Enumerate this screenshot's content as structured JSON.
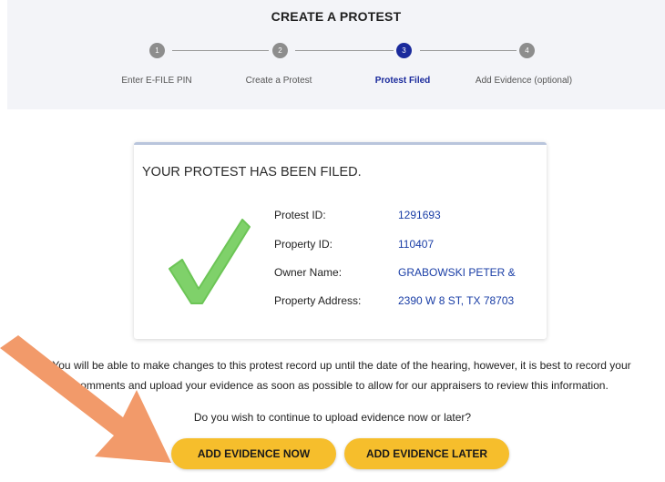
{
  "header": {
    "title": "CREATE A PROTEST",
    "steps": [
      {
        "number": "1",
        "label": "Enter E-FILE PIN"
      },
      {
        "number": "2",
        "label": "Create a Protest"
      },
      {
        "number": "3",
        "label": "Protest Filed",
        "active": true
      },
      {
        "number": "4",
        "label": "Add Evidence (optional)"
      }
    ]
  },
  "card": {
    "title": "YOUR PROTEST HAS BEEN FILED.",
    "rows": [
      {
        "label": "Protest ID:",
        "value": "1291693"
      },
      {
        "label": "Property ID:",
        "value": "110407"
      },
      {
        "label": "Owner Name:",
        "value": "GRABOWSKI PETER &"
      },
      {
        "label": "Property Address:",
        "value": "2390 W 8 ST, TX 78703"
      }
    ]
  },
  "info": {
    "line1": "You will be able to make changes to this protest record up until the date of the hearing, however, it is best to record your",
    "line2": "comments and upload your evidence as soon as possible to allow for our appraisers to review this information."
  },
  "question": "Do you wish to continue to upload evidence now or later?",
  "buttons": {
    "now": "ADD EVIDENCE NOW",
    "later": "ADD EVIDENCE LATER"
  },
  "colors": {
    "active_step": "#1a2a9c",
    "link_value": "#1a3ea6",
    "button": "#f6be2c",
    "check": "#7fd16a",
    "arrow": "#f29a6a"
  }
}
